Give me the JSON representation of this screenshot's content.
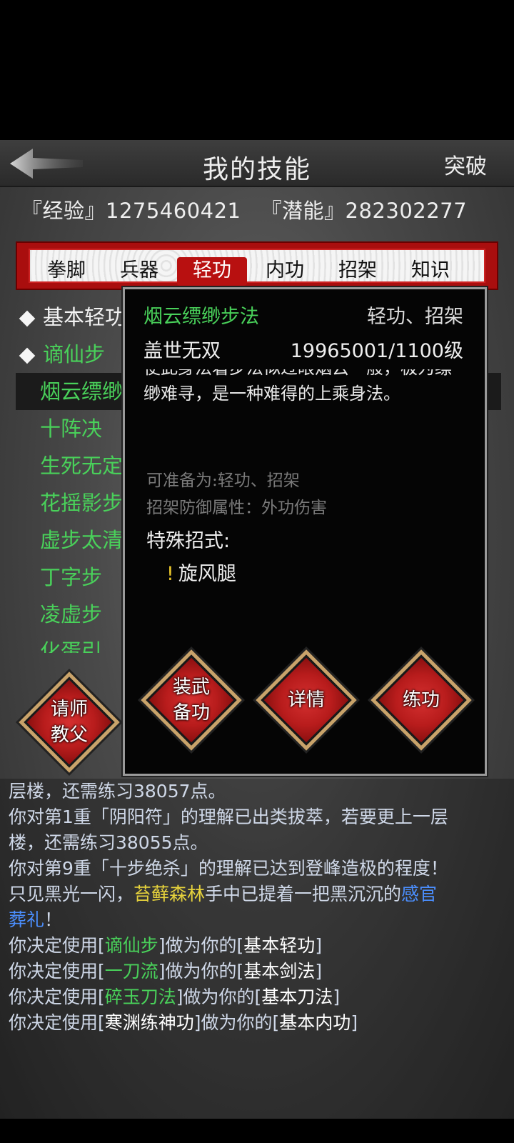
{
  "header": {
    "title": "我的技能",
    "breakthrough": "突破"
  },
  "stats": {
    "exp": "『经验』1275460421",
    "potential": "『潜能』282302277"
  },
  "tabs": [
    "拳脚",
    "兵器",
    "轻功",
    "内功",
    "招架",
    "知识"
  ],
  "active_tab": "轻功",
  "skills": [
    {
      "label": "基本轻功",
      "marker": "diamond",
      "color": "white"
    },
    {
      "label": "谪仙步",
      "marker": "diamond",
      "color": "green"
    },
    {
      "label": "烟云缥缈步法",
      "marker": "none",
      "color": "green",
      "selected": true
    },
    {
      "label": "十阵决",
      "marker": "none",
      "color": "green"
    },
    {
      "label": "生死无定",
      "marker": "none",
      "color": "green"
    },
    {
      "label": "花摇影步",
      "marker": "none",
      "color": "green"
    },
    {
      "label": "虚步太清",
      "marker": "none",
      "color": "green"
    },
    {
      "label": "丁字步",
      "marker": "none",
      "color": "green"
    },
    {
      "label": "凌虚步",
      "marker": "none",
      "color": "green"
    },
    {
      "label": "化蛋引",
      "marker": "none",
      "color": "green"
    }
  ],
  "teacher_button": {
    "line1": "请师",
    "line2": "教父"
  },
  "popup": {
    "name": "烟云缥缈步法",
    "type": "轻功、招架",
    "rank": "盖世无双",
    "level": "19965001/1100级",
    "description": "使此身法着步法似过眼烟云一般，极为缥缈难寻，是一种难得的上乘身法。",
    "prepare": "可准备为:轻功、招架",
    "defense": "招架防御属性：外功伤害",
    "special_title": "特殊招式:",
    "special_marker": "!",
    "special_move": "旋风腿",
    "btn_equip_line1": "装武",
    "btn_equip_line2": "备功",
    "btn_detail": "详情",
    "btn_practice": "练功"
  },
  "log": {
    "l1": "层楼，还需练习38057点。",
    "l2": "你对第1重「阴阳符」的理解已出类拔萃，若要更上一层",
    "l3": "楼，还需练习38055点。",
    "l4": "你对第9重「十步绝杀」的理解已达到登峰造极的程度！",
    "l5a": "只见黑光一闪，",
    "l5b": "苔藓森林",
    "l5c": "手中已提着一把黑沉沉的",
    "l5d": "感官",
    "l6a": "葬礼",
    "l6b": "！",
    "l7a": "你决定使用[",
    "l7b": "谪仙步",
    "l7c": "]做为你的[",
    "l7d": "基本轻功",
    "l7e": "]",
    "l8a": "你决定使用[",
    "l8b": "一刀流",
    "l8c": "]做为你的[",
    "l8d": "基本剑法",
    "l8e": "]",
    "l9a": "你决定使用[",
    "l9b": "碎玉刀法",
    "l9c": "]做为你的[",
    "l9d": "基本刀法",
    "l9e": "]",
    "l10a": "你决定使用[",
    "l10b": "寒渊练神功",
    "l10c": "]做为你的[",
    "l10d": "基本内功",
    "l10e": "]"
  }
}
